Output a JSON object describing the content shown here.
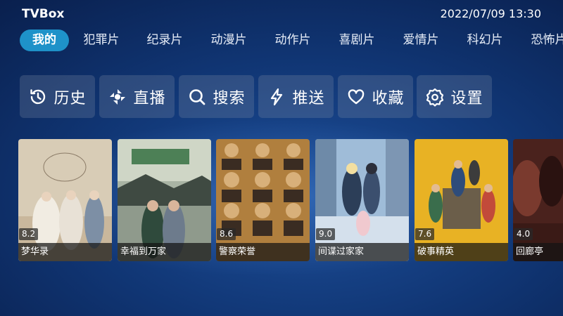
{
  "header": {
    "app_title": "TVBox",
    "datetime": "2022/07/09 13:30"
  },
  "categories": [
    {
      "label": "我的",
      "active": true
    },
    {
      "label": "犯罪片"
    },
    {
      "label": "纪录片"
    },
    {
      "label": "动漫片"
    },
    {
      "label": "动作片"
    },
    {
      "label": "喜剧片"
    },
    {
      "label": "爱情片"
    },
    {
      "label": "科幻片"
    },
    {
      "label": "恐怖片"
    }
  ],
  "quick_actions": [
    {
      "label": "历史",
      "icon": "history-icon"
    },
    {
      "label": "直播",
      "icon": "live-icon"
    },
    {
      "label": "搜索",
      "icon": "search-icon"
    },
    {
      "label": "推送",
      "icon": "push-lightning-icon"
    },
    {
      "label": "收藏",
      "icon": "heart-icon"
    },
    {
      "label": "设置",
      "icon": "gear-icon"
    }
  ],
  "movies": [
    {
      "title": "梦华录",
      "rating": "8.2",
      "poster_color": "#d9cbb4"
    },
    {
      "title": "幸福到万家",
      "rating": "",
      "poster_color": "#5e7a5e"
    },
    {
      "title": "警察荣誉",
      "rating": "8.6",
      "poster_color": "#b8843f"
    },
    {
      "title": "间谍过家家",
      "rating": "9.0",
      "poster_color": "#8fb0cf"
    },
    {
      "title": "破事精英",
      "rating": "7.6",
      "poster_color": "#e8b324"
    },
    {
      "title": "回廊亭",
      "rating": "4.0",
      "poster_color": "#5a2a24"
    }
  ]
}
